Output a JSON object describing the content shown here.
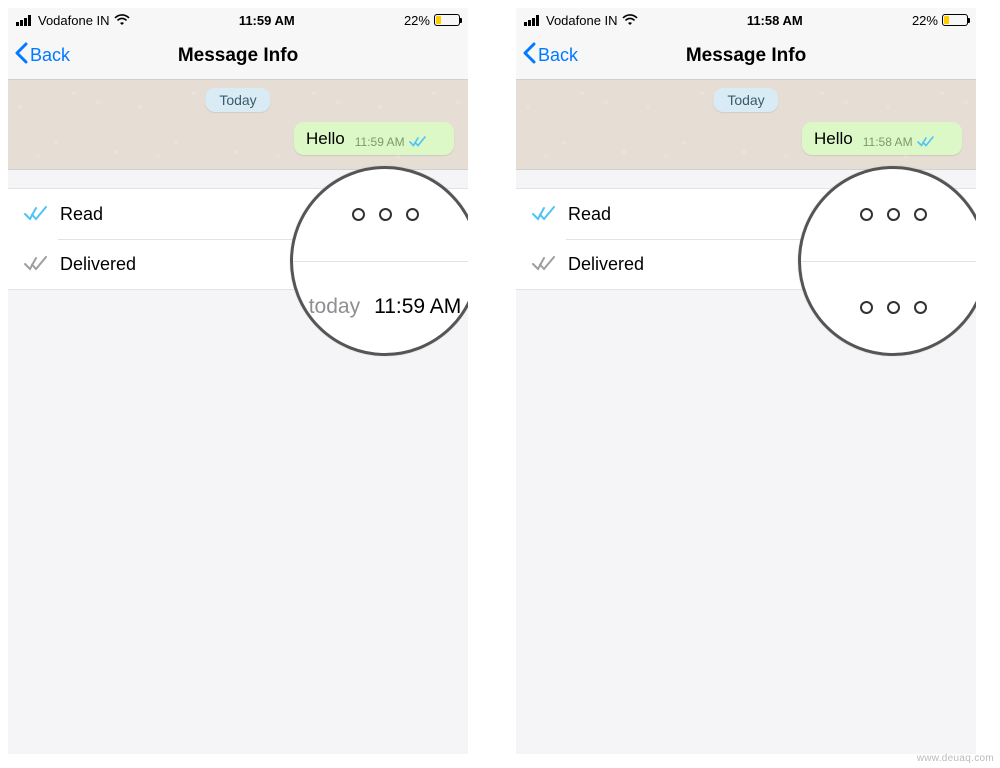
{
  "watermark": "www.deuaq.com",
  "screens": [
    {
      "statusbar": {
        "carrier": "Vodafone IN",
        "time": "11:59 AM",
        "battery_pct": "22%"
      },
      "nav": {
        "back": "Back",
        "title": "Message Info"
      },
      "chat": {
        "date": "Today",
        "bubble_text": "Hello",
        "bubble_time": "11:59 AM"
      },
      "rows": {
        "read_label": "Read",
        "delivered_label": "Delivered"
      },
      "magnifier": {
        "row1_dots": true,
        "row2_type": "time",
        "row2_day": "today",
        "row2_time": "11:59 AM"
      }
    },
    {
      "statusbar": {
        "carrier": "Vodafone IN",
        "time": "11:58 AM",
        "battery_pct": "22%"
      },
      "nav": {
        "back": "Back",
        "title": "Message Info"
      },
      "chat": {
        "date": "Today",
        "bubble_text": "Hello",
        "bubble_time": "11:58 AM"
      },
      "rows": {
        "read_label": "Read",
        "delivered_label": "Delivered"
      },
      "magnifier": {
        "row1_dots": true,
        "row2_type": "dots"
      }
    }
  ]
}
